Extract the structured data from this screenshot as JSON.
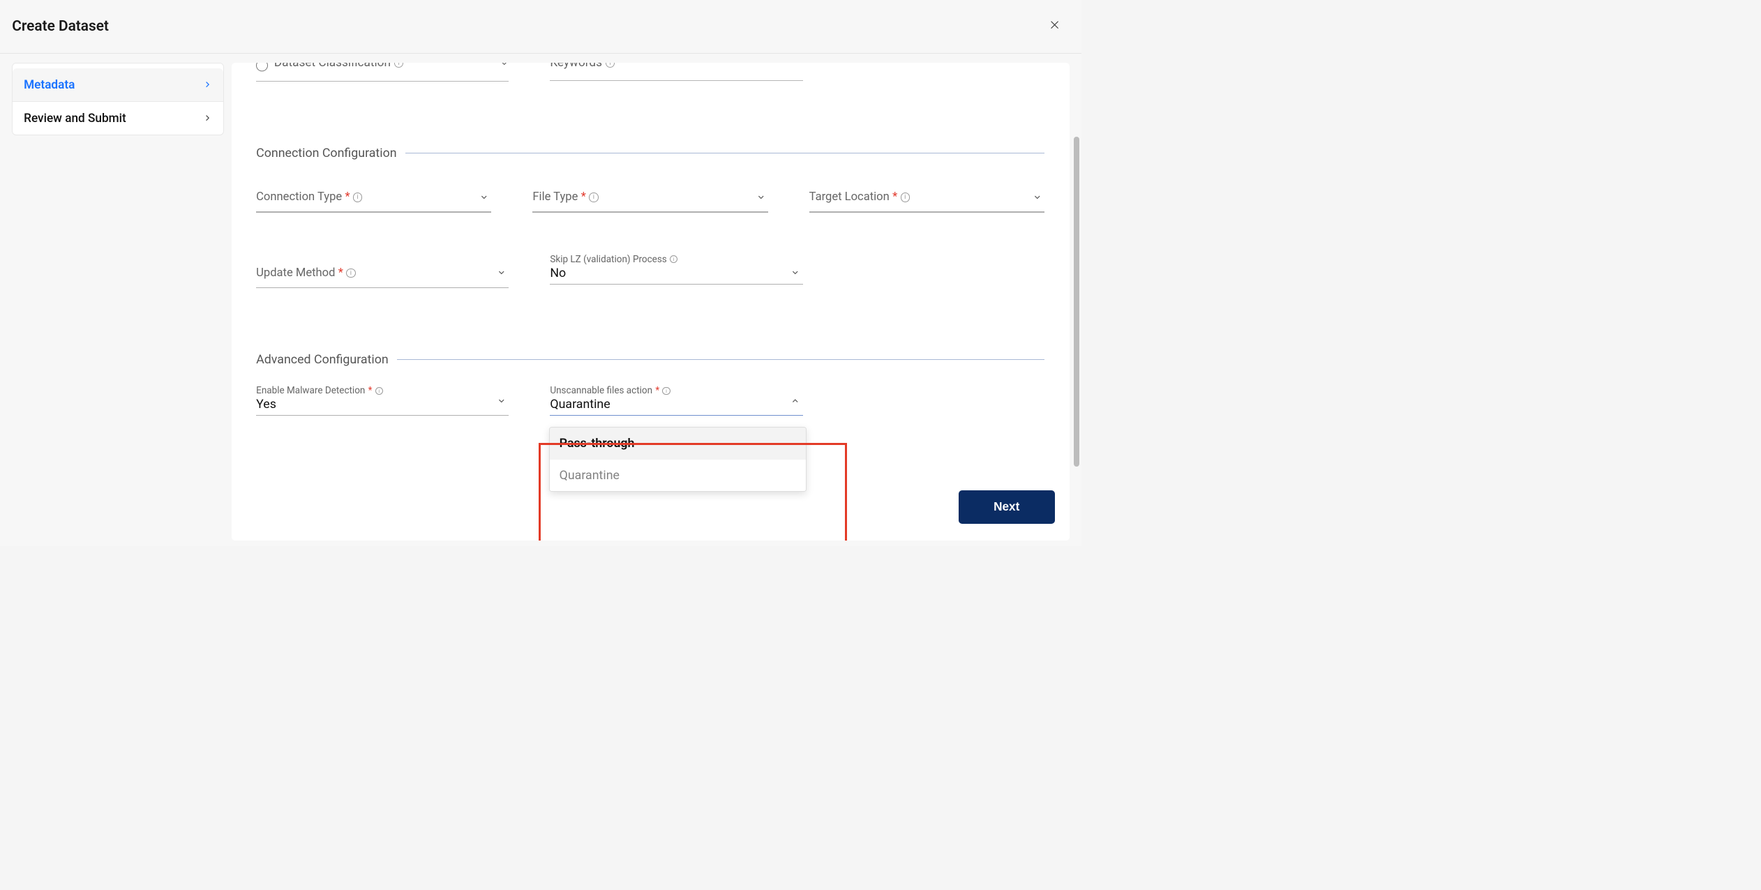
{
  "header": {
    "title": "Create Dataset"
  },
  "sidebar": {
    "items": [
      {
        "label": "Metadata",
        "active": true
      },
      {
        "label": "Review and Submit",
        "active": false
      }
    ]
  },
  "peek": {
    "field1_label": "Dataset Classification",
    "field2_label": "Keywords"
  },
  "sections": {
    "connection": {
      "title": "Connection Configuration",
      "fields": {
        "connection_type_label": "Connection Type",
        "file_type_label": "File Type",
        "target_location_label": "Target Location",
        "update_method_label": "Update Method",
        "skip_lz_label": "Skip LZ (validation) Process",
        "skip_lz_value": "No"
      }
    },
    "advanced": {
      "title": "Advanced Configuration",
      "fields": {
        "malware_label": "Enable Malware Detection",
        "malware_value": "Yes",
        "unscannable_label": "Unscannable files action",
        "unscannable_value": "Quarantine",
        "options": [
          "Pass-through",
          "Quarantine"
        ]
      }
    }
  },
  "footer": {
    "next_label": "Next"
  },
  "required_mark": "*"
}
